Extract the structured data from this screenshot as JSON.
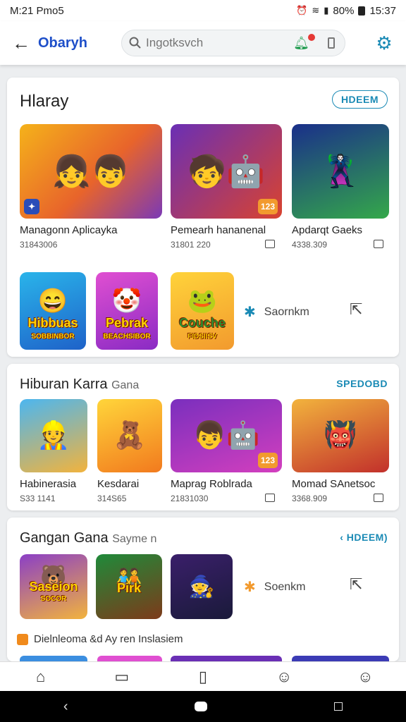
{
  "status": {
    "time": "M:21 Pmo5",
    "battery": "80%",
    "clock": "15:37"
  },
  "appbar": {
    "title": "Obaryh",
    "search_placeholder": "Ingotksvch"
  },
  "sections": [
    {
      "title": "Hlaray",
      "see_all": "HDEEM",
      "games": [
        {
          "name": "Managonn Aplicayka",
          "meta": "31843006"
        },
        {
          "name": "Pemearh hananenal",
          "meta": "31801 220"
        },
        {
          "name": "Apdarqt Gaeks",
          "meta": "4338.309"
        }
      ],
      "small_tiles": [
        {
          "word": "Hibbuas",
          "caption": "SOBBINBOR"
        },
        {
          "word": "Pebrak",
          "caption": "BEACHSIBOR"
        },
        {
          "word": "Couche",
          "caption": "FIDSIISV"
        }
      ],
      "action": "Saornkm"
    },
    {
      "title": "Hiburan Karra",
      "subtitle": "Gana",
      "see_all": "SPEDOBD",
      "games": [
        {
          "name": "Habinerasia",
          "meta": "S33 1141"
        },
        {
          "name": "Kesdarai",
          "meta": "314S65"
        },
        {
          "name": "Maprag Roblrada",
          "meta": "21831030"
        },
        {
          "name": "Momad SAnetsoc",
          "meta": "3368.909"
        }
      ]
    },
    {
      "title": "Gangan Gana",
      "subtitle": "Sayme n",
      "see_all": "HDEEM)",
      "small_tiles": [
        {
          "word": "Saseion",
          "caption": "SOCOR"
        },
        {
          "word": "Pirk",
          "caption": ""
        },
        {
          "word": "",
          "caption": ""
        }
      ],
      "action": "Soenkm"
    }
  ],
  "footer": {
    "label": "Dielnleoma &d Ay ren Inslasiem"
  },
  "badges": {
    "b1": "123",
    "b2": "123"
  }
}
